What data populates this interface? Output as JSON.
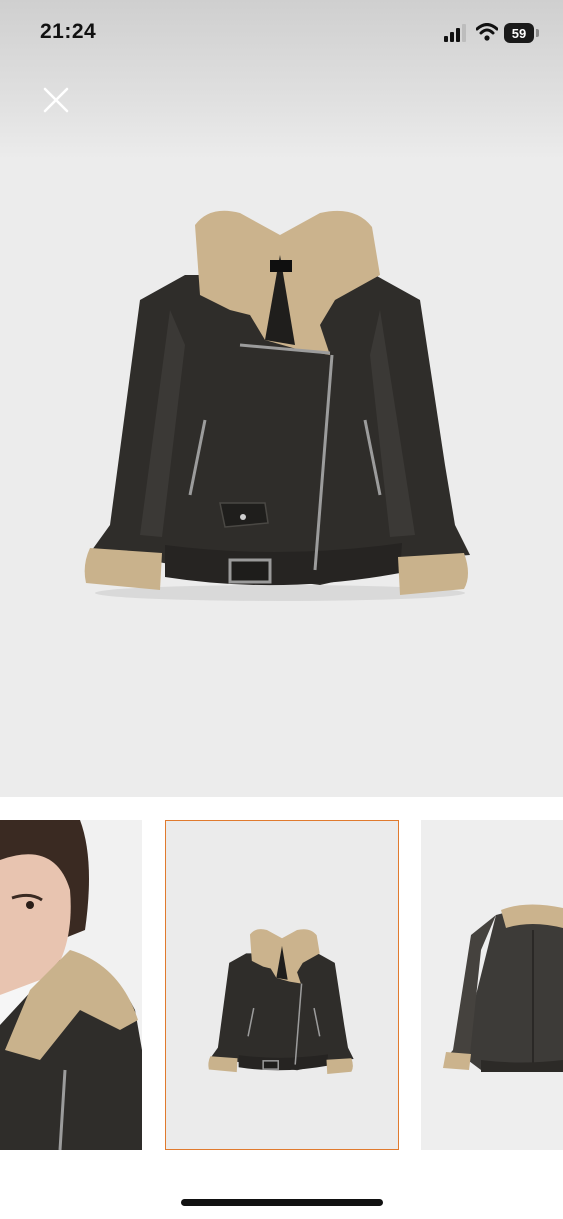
{
  "status_bar": {
    "time": "21:24",
    "battery_level": "59",
    "icons": [
      "signal-icon",
      "wifi-icon",
      "battery-icon"
    ]
  },
  "viewer": {
    "close_icon": "close-icon",
    "main_image": "product-jacket-front-image"
  },
  "thumbnails": [
    {
      "image": "model-wearing-jacket-closeup",
      "selected": false
    },
    {
      "image": "product-jacket-front-image",
      "selected": true
    },
    {
      "image": "product-jacket-back-image",
      "selected": false
    }
  ],
  "colors": {
    "selected_thumbnail_border": "#e07a2e",
    "viewer_background": "#ececec",
    "jacket_leather": "#2f2d2a",
    "jacket_shearling": "#cbb38d"
  }
}
